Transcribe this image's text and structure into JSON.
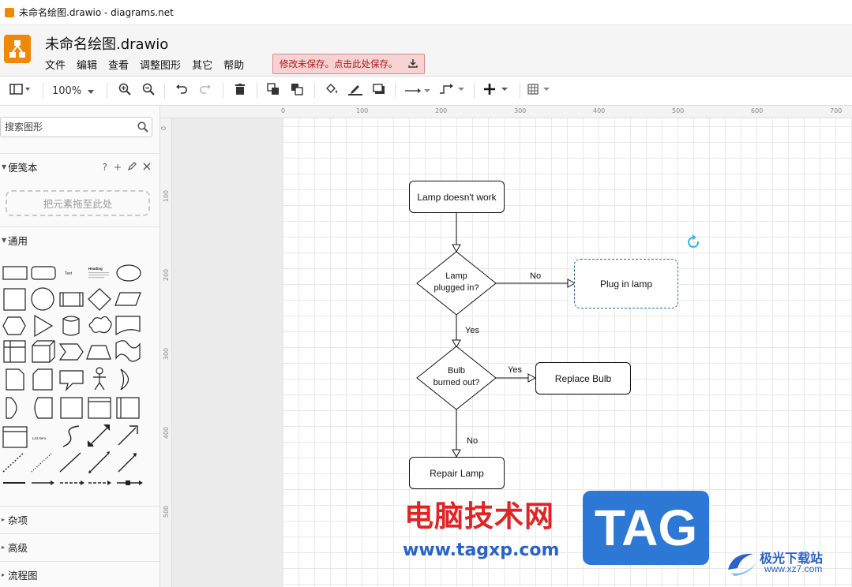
{
  "window": {
    "title": "未命名绘图.drawio - diagrams.net"
  },
  "app": {
    "doc_title": "未命名绘图.drawio"
  },
  "menu": [
    "文件",
    "编辑",
    "查看",
    "调整图形",
    "其它",
    "帮助"
  ],
  "unsaved_notice": "修改未保存。点击此处保存。",
  "toolbar": {
    "zoom": "100%"
  },
  "sidebar": {
    "search_placeholder": "搜索图形",
    "scratchpad": "便笺本",
    "scratchpad_tools": [
      "?",
      "+"
    ],
    "drop_hint": "把元素拖至此处",
    "general": "通用",
    "misc": "杂项",
    "advanced": "高级",
    "flowchart": "流程图",
    "shape_text": "Text",
    "shape_heading": "Heading",
    "shape_list_item": "List Item"
  },
  "rulers": {
    "top": [
      "0",
      "100",
      "200",
      "300",
      "400",
      "500",
      "600",
      "700"
    ],
    "left": [
      "0",
      "100",
      "200",
      "300",
      "400",
      "500"
    ]
  },
  "diagram": {
    "nodes": {
      "start": "Lamp doesn't work",
      "decision1_line1": "Lamp",
      "decision1_line2": "plugged in?",
      "plug": "Plug in lamp",
      "decision2_line1": "Bulb",
      "decision2_line2": "burned out?",
      "replace": "Replace Bulb",
      "repair": "Repair Lamp"
    },
    "edges": {
      "no1": "No",
      "yes1": "Yes",
      "yes2": "Yes",
      "no2": "No"
    }
  },
  "watermark": {
    "brand_cn": "电脑技术网",
    "url": "www.tagxp.com",
    "tag": "TAG",
    "site2_cn": "极光下载站",
    "site2_url": "www.xz7.com"
  },
  "colors": {
    "accent": "#f08705",
    "unsaved_bg": "#f6d2d2",
    "unsaved_text": "#b01818",
    "selection": "#29b6f2"
  }
}
